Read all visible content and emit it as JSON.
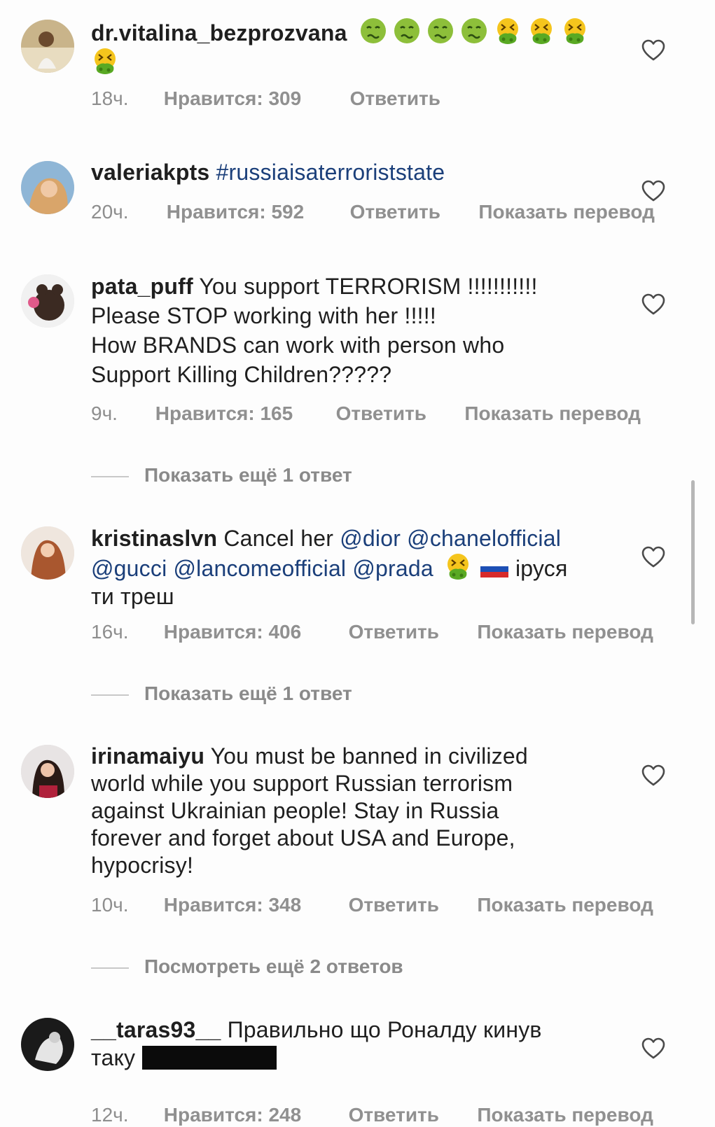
{
  "comments": [
    {
      "user": "dr.vitalina_bezprozvana",
      "text": "",
      "time": "18ч.",
      "likes": "Нравится: 309",
      "reply": "Ответить",
      "translate": ""
    },
    {
      "user": "valeriakpts",
      "text": "#russiaisaterroriststate",
      "time": "20ч.",
      "likes": "Нравится: 592",
      "reply": "Ответить",
      "translate": "Показать перевод"
    },
    {
      "user": "pata_puff",
      "text_line1": "You support TERRORISM !!!!!!!!!!!",
      "text_line2": "Please STOP working with her !!!!!",
      "text_line3": "How BRANDS can work with person who",
      "text_line4": "Support Killing Children?????",
      "time": "9ч.",
      "likes": "Нравится: 165",
      "reply": "Ответить",
      "translate": "Показать перевод",
      "more_replies": "Показать ещё 1 ответ"
    },
    {
      "user": "kristinaslvn",
      "text_pre": "Cancel her",
      "mention1": "@dior",
      "mention2": "@chanelofficial",
      "mention3": "@gucci",
      "mention4": "@lancomeofficial",
      "mention5": "@prada",
      "text_post1": "іруся",
      "text_post2": "ти треш",
      "time": "16ч.",
      "likes": "Нравится: 406",
      "reply": "Ответить",
      "translate": "Показать перевод",
      "more_replies": "Показать ещё 1 ответ"
    },
    {
      "user": "irinamaiyu",
      "text_line1": "You must be banned in civilized",
      "text_line2": "world while you support Russian terrorism",
      "text_line3": "against Ukrainian people! Stay in Russia",
      "text_line4": "forever and forget about USA and Europe,",
      "text_line5": "hypocrisy!",
      "time": "10ч.",
      "likes": "Нравится: 348",
      "reply": "Ответить",
      "translate": "Показать перевод",
      "more_replies": "Посмотреть ещё 2 ответов"
    },
    {
      "user": "__taras93__",
      "text_line1": "Правильно що Роналду кинув",
      "text_line2": "таку",
      "time": "12ч.",
      "likes": "Нравится: 248",
      "reply": "Ответить",
      "translate": "Показать перевод"
    }
  ],
  "colors": {
    "hashtag": "#1b3f7a",
    "meta": "#8a8a8a",
    "text": "#1f1f1f"
  },
  "icons": {
    "like": "heart-outline-icon",
    "sick_face": "nauseated-face-emoji",
    "vomit_face": "vomiting-face-emoji",
    "flag": "russia-flag-emoji"
  }
}
